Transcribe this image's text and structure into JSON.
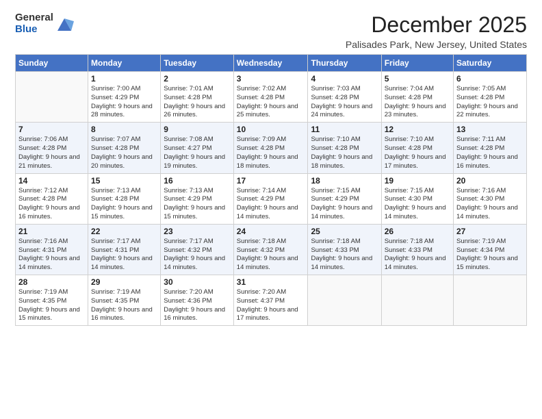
{
  "logo": {
    "general": "General",
    "blue": "Blue"
  },
  "title": "December 2025",
  "location": "Palisades Park, New Jersey, United States",
  "days_header": [
    "Sunday",
    "Monday",
    "Tuesday",
    "Wednesday",
    "Thursday",
    "Friday",
    "Saturday"
  ],
  "weeks": [
    [
      {
        "day": "",
        "sunrise": "",
        "sunset": "",
        "daylight": ""
      },
      {
        "day": "1",
        "sunrise": "Sunrise: 7:00 AM",
        "sunset": "Sunset: 4:29 PM",
        "daylight": "Daylight: 9 hours and 28 minutes."
      },
      {
        "day": "2",
        "sunrise": "Sunrise: 7:01 AM",
        "sunset": "Sunset: 4:28 PM",
        "daylight": "Daylight: 9 hours and 26 minutes."
      },
      {
        "day": "3",
        "sunrise": "Sunrise: 7:02 AM",
        "sunset": "Sunset: 4:28 PM",
        "daylight": "Daylight: 9 hours and 25 minutes."
      },
      {
        "day": "4",
        "sunrise": "Sunrise: 7:03 AM",
        "sunset": "Sunset: 4:28 PM",
        "daylight": "Daylight: 9 hours and 24 minutes."
      },
      {
        "day": "5",
        "sunrise": "Sunrise: 7:04 AM",
        "sunset": "Sunset: 4:28 PM",
        "daylight": "Daylight: 9 hours and 23 minutes."
      },
      {
        "day": "6",
        "sunrise": "Sunrise: 7:05 AM",
        "sunset": "Sunset: 4:28 PM",
        "daylight": "Daylight: 9 hours and 22 minutes."
      }
    ],
    [
      {
        "day": "7",
        "sunrise": "Sunrise: 7:06 AM",
        "sunset": "Sunset: 4:28 PM",
        "daylight": "Daylight: 9 hours and 21 minutes."
      },
      {
        "day": "8",
        "sunrise": "Sunrise: 7:07 AM",
        "sunset": "Sunset: 4:28 PM",
        "daylight": "Daylight: 9 hours and 20 minutes."
      },
      {
        "day": "9",
        "sunrise": "Sunrise: 7:08 AM",
        "sunset": "Sunset: 4:27 PM",
        "daylight": "Daylight: 9 hours and 19 minutes."
      },
      {
        "day": "10",
        "sunrise": "Sunrise: 7:09 AM",
        "sunset": "Sunset: 4:28 PM",
        "daylight": "Daylight: 9 hours and 18 minutes."
      },
      {
        "day": "11",
        "sunrise": "Sunrise: 7:10 AM",
        "sunset": "Sunset: 4:28 PM",
        "daylight": "Daylight: 9 hours and 18 minutes."
      },
      {
        "day": "12",
        "sunrise": "Sunrise: 7:10 AM",
        "sunset": "Sunset: 4:28 PM",
        "daylight": "Daylight: 9 hours and 17 minutes."
      },
      {
        "day": "13",
        "sunrise": "Sunrise: 7:11 AM",
        "sunset": "Sunset: 4:28 PM",
        "daylight": "Daylight: 9 hours and 16 minutes."
      }
    ],
    [
      {
        "day": "14",
        "sunrise": "Sunrise: 7:12 AM",
        "sunset": "Sunset: 4:28 PM",
        "daylight": "Daylight: 9 hours and 16 minutes."
      },
      {
        "day": "15",
        "sunrise": "Sunrise: 7:13 AM",
        "sunset": "Sunset: 4:28 PM",
        "daylight": "Daylight: 9 hours and 15 minutes."
      },
      {
        "day": "16",
        "sunrise": "Sunrise: 7:13 AM",
        "sunset": "Sunset: 4:29 PM",
        "daylight": "Daylight: 9 hours and 15 minutes."
      },
      {
        "day": "17",
        "sunrise": "Sunrise: 7:14 AM",
        "sunset": "Sunset: 4:29 PM",
        "daylight": "Daylight: 9 hours and 14 minutes."
      },
      {
        "day": "18",
        "sunrise": "Sunrise: 7:15 AM",
        "sunset": "Sunset: 4:29 PM",
        "daylight": "Daylight: 9 hours and 14 minutes."
      },
      {
        "day": "19",
        "sunrise": "Sunrise: 7:15 AM",
        "sunset": "Sunset: 4:30 PM",
        "daylight": "Daylight: 9 hours and 14 minutes."
      },
      {
        "day": "20",
        "sunrise": "Sunrise: 7:16 AM",
        "sunset": "Sunset: 4:30 PM",
        "daylight": "Daylight: 9 hours and 14 minutes."
      }
    ],
    [
      {
        "day": "21",
        "sunrise": "Sunrise: 7:16 AM",
        "sunset": "Sunset: 4:31 PM",
        "daylight": "Daylight: 9 hours and 14 minutes."
      },
      {
        "day": "22",
        "sunrise": "Sunrise: 7:17 AM",
        "sunset": "Sunset: 4:31 PM",
        "daylight": "Daylight: 9 hours and 14 minutes."
      },
      {
        "day": "23",
        "sunrise": "Sunrise: 7:17 AM",
        "sunset": "Sunset: 4:32 PM",
        "daylight": "Daylight: 9 hours and 14 minutes."
      },
      {
        "day": "24",
        "sunrise": "Sunrise: 7:18 AM",
        "sunset": "Sunset: 4:32 PM",
        "daylight": "Daylight: 9 hours and 14 minutes."
      },
      {
        "day": "25",
        "sunrise": "Sunrise: 7:18 AM",
        "sunset": "Sunset: 4:33 PM",
        "daylight": "Daylight: 9 hours and 14 minutes."
      },
      {
        "day": "26",
        "sunrise": "Sunrise: 7:18 AM",
        "sunset": "Sunset: 4:33 PM",
        "daylight": "Daylight: 9 hours and 14 minutes."
      },
      {
        "day": "27",
        "sunrise": "Sunrise: 7:19 AM",
        "sunset": "Sunset: 4:34 PM",
        "daylight": "Daylight: 9 hours and 15 minutes."
      }
    ],
    [
      {
        "day": "28",
        "sunrise": "Sunrise: 7:19 AM",
        "sunset": "Sunset: 4:35 PM",
        "daylight": "Daylight: 9 hours and 15 minutes."
      },
      {
        "day": "29",
        "sunrise": "Sunrise: 7:19 AM",
        "sunset": "Sunset: 4:35 PM",
        "daylight": "Daylight: 9 hours and 16 minutes."
      },
      {
        "day": "30",
        "sunrise": "Sunrise: 7:20 AM",
        "sunset": "Sunset: 4:36 PM",
        "daylight": "Daylight: 9 hours and 16 minutes."
      },
      {
        "day": "31",
        "sunrise": "Sunrise: 7:20 AM",
        "sunset": "Sunset: 4:37 PM",
        "daylight": "Daylight: 9 hours and 17 minutes."
      },
      {
        "day": "",
        "sunrise": "",
        "sunset": "",
        "daylight": ""
      },
      {
        "day": "",
        "sunrise": "",
        "sunset": "",
        "daylight": ""
      },
      {
        "day": "",
        "sunrise": "",
        "sunset": "",
        "daylight": ""
      }
    ]
  ]
}
